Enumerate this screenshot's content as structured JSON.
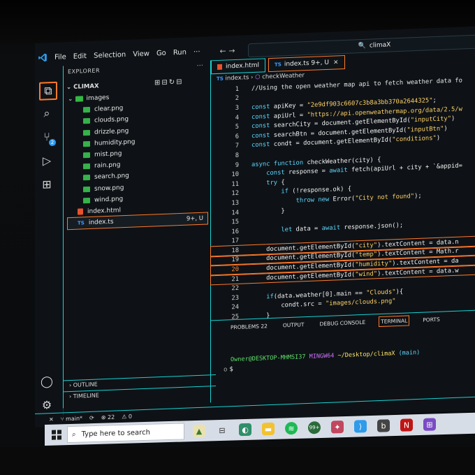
{
  "title": {
    "menu": [
      "File",
      "Edit",
      "Selection",
      "View",
      "Go",
      "Run",
      "···"
    ],
    "nav": "← →",
    "search": "climaX"
  },
  "activity_bar": {
    "icons": [
      "files-icon",
      "search-icon",
      "source-control-icon",
      "run-debug-icon",
      "extensions-icon"
    ],
    "source_control_badge": "2",
    "bottom": [
      "account-icon",
      "settings-icon"
    ]
  },
  "sidebar": {
    "title": "EXPLORER",
    "dots": "···",
    "project": "CLIMAX",
    "tools": "⊞⊟↻⊟",
    "folder": "images",
    "files": [
      "clear.png",
      "clouds.png",
      "drizzle.png",
      "humidity.png",
      "mist.png",
      "rain.png",
      "search.png",
      "snow.png",
      "wind.png"
    ],
    "root_files": [
      {
        "name": "index.html",
        "type": "html",
        "badge": ""
      },
      {
        "name": "index.ts",
        "type": "ts",
        "badge": "9+, U"
      }
    ],
    "outline": "OUTLINE",
    "timeline": "TIMELINE"
  },
  "editor": {
    "tabs": [
      {
        "label": "index.html",
        "type": "html"
      },
      {
        "label": "index.ts 9+, U",
        "type": "ts",
        "close": "×"
      }
    ],
    "breadcrumb": {
      "file": "index.ts",
      "sep": "›",
      "symbol": "checkWeather"
    },
    "lines": [
      {
        "n": "1",
        "t": "//Using the open weather map api to fetch weather data fo"
      },
      {
        "n": "2",
        "t": ""
      },
      {
        "n": "3",
        "t": "const apiKey = \"2e9df903c6607c3b8a3bb370a2644325\";"
      },
      {
        "n": "4",
        "t": "const apiUrl = \"https://api.openweathermap.org/data/2.5/w"
      },
      {
        "n": "5",
        "t": "const searchCity = document.getElementById(\"inputCity\")"
      },
      {
        "n": "6",
        "t": "const searchBtn = document.getElementById(\"inputBtn\")"
      },
      {
        "n": "7",
        "t": "const condt = document.getElementById(\"conditions\")"
      },
      {
        "n": "8",
        "t": ""
      },
      {
        "n": "9",
        "t": "async function checkWeather(city) {"
      },
      {
        "n": "10",
        "t": "    const response = await fetch(apiUrl + city + `&appid="
      },
      {
        "n": "11",
        "t": "    try {"
      },
      {
        "n": "12",
        "t": "        if (!response.ok) {"
      },
      {
        "n": "13",
        "t": "            throw new Error(\"City not found\");"
      },
      {
        "n": "14",
        "t": "        }"
      },
      {
        "n": "15",
        "t": ""
      },
      {
        "n": "16",
        "t": "        let data = await response.json();"
      },
      {
        "n": "17",
        "t": ""
      },
      {
        "n": "18",
        "t": "    document.getElementById(\"city\").textContent = data.n"
      },
      {
        "n": "19",
        "t": "    document.getElementById(\"temp\").textContent = Math.r"
      },
      {
        "n": "20",
        "t": "    document.getElementById(\"humidity\").textContent = da"
      },
      {
        "n": "21",
        "t": "    document.getElementById(\"wind\").textContent = data.w"
      },
      {
        "n": "22",
        "t": ""
      },
      {
        "n": "23",
        "t": "    if(data.weather[0].main == \"Clouds\"){"
      },
      {
        "n": "24",
        "t": "        condt.src = \"images/clouds.png\""
      },
      {
        "n": "25",
        "t": "    }"
      }
    ]
  },
  "panel": {
    "tabs": [
      {
        "label": "PROBLEMS",
        "count": "22"
      },
      {
        "label": "OUTPUT"
      },
      {
        "label": "DEBUG CONSOLE"
      },
      {
        "label": "TERMINAL"
      },
      {
        "label": "PORTS"
      }
    ],
    "prompt_user": "Owner@DESKTOP-MHMSI37",
    "prompt_shell": "MINGW64",
    "prompt_path": "~/Desktop/climaX",
    "prompt_branch": "(main)",
    "prompt_marker": "o",
    "prompt_symbol": "$"
  },
  "status": {
    "branch": "main*",
    "sync": "⟳",
    "errors": "⊗ 22",
    "warnings": "⚠ 0"
  },
  "taskbar": {
    "search_placeholder": "Type here to search",
    "notification": "99+"
  },
  "colors": {
    "accent": "#ff7a2b",
    "cyan_border": "#18d3d3",
    "keyword": "#5fd7ff",
    "string": "#ffd166",
    "comment": "#e6e6e6"
  }
}
